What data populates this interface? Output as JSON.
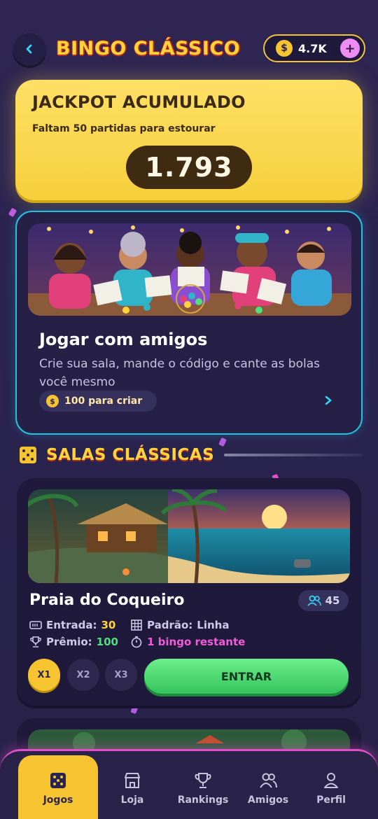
{
  "header": {
    "title": "BINGO CLÁSSICO",
    "coins": "4.7K",
    "plus": "+",
    "back_icon": "chevron-left-icon"
  },
  "jackpot": {
    "title": "JACKPOT ACUMULADO",
    "subtitle": "Faltam 50 partidas para estourar",
    "value": "1.793"
  },
  "friends": {
    "title": "Jogar com amigos",
    "description": "Crie sua sala, mande o código e cante as bolas você mesmo",
    "cost": "100 para criar"
  },
  "section": {
    "title": "SALAS CLÁSSICAS"
  },
  "room": {
    "name": "Praia do Coqueiro",
    "players": "45",
    "entry_label": "Entrada:",
    "entry_value": "30",
    "pattern_label": "Padrão:",
    "pattern_value": "Linha",
    "prize_label": "Prêmio:",
    "prize_value": "100",
    "remaining": "1 bingo restante",
    "multipliers": [
      "X1",
      "X2",
      "X3"
    ],
    "enter_label": "ENTRAR"
  },
  "nav": {
    "items": [
      {
        "label": "Jogos",
        "icon": "dice-icon",
        "active": true
      },
      {
        "label": "Loja",
        "icon": "store-icon"
      },
      {
        "label": "Rankings",
        "icon": "trophy-icon"
      },
      {
        "label": "Amigos",
        "icon": "users-icon"
      },
      {
        "label": "Perfil",
        "icon": "user-icon"
      }
    ]
  },
  "colors": {
    "background": "#2a2450",
    "accent_yellow": "#ffd43b",
    "accent_cyan": "#23c3dd",
    "accent_pink": "#e24fc9",
    "accent_green": "#4ee07a"
  }
}
